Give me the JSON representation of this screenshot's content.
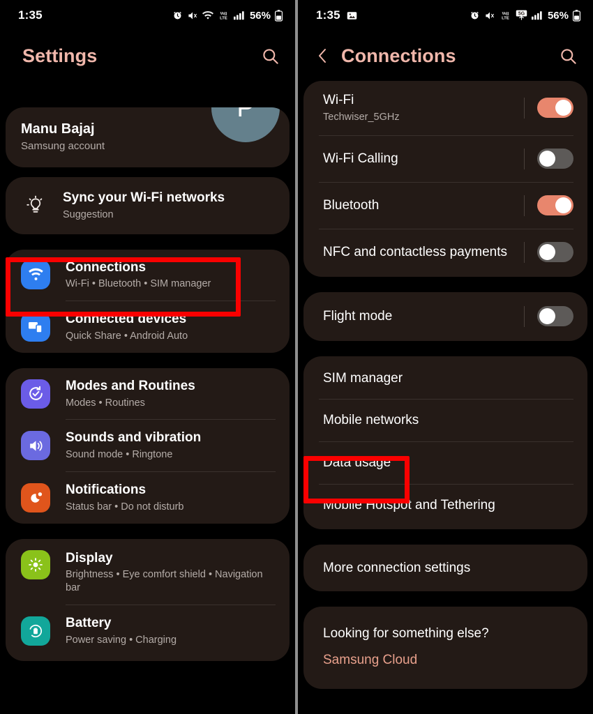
{
  "accent": "#f0b7ab",
  "highlight_color": "#fa0000",
  "card_bg": "#231a16",
  "toggle_on_color": "#e8866d",
  "toggle_off_color": "#5d5a58",
  "left_panel": {
    "statusbar": {
      "time": "1:35",
      "battery": "56%",
      "icons": [
        "alarm-icon",
        "mute-icon",
        "wifi-icon",
        "volte-icon",
        "signal-icon",
        "battery-icon"
      ]
    },
    "header": {
      "title": "Settings",
      "search_icon": "search-icon"
    },
    "profile": {
      "name": "Manu Bajaj",
      "subtitle": "Samsung account",
      "avatar_initial": "P"
    },
    "suggestion": {
      "title": "Sync your Wi-Fi networks",
      "subtitle": "Suggestion",
      "icon": "lightbulb-icon"
    },
    "groups": [
      {
        "items": [
          {
            "title": "Connections",
            "subtitle": "Wi-Fi  •  Bluetooth  •  SIM manager",
            "icon": "wifi-icon",
            "icon_color": "#2e7ef0",
            "highlighted": true
          },
          {
            "title": "Connected devices",
            "subtitle": "Quick Share  •  Android Auto",
            "icon": "devices-icon",
            "icon_color": "#2e7ef0",
            "highlighted": false
          }
        ]
      },
      {
        "items": [
          {
            "title": "Modes and Routines",
            "subtitle": "Modes  •  Routines",
            "icon": "modes-icon",
            "icon_color": "#6b5ce7",
            "highlighted": false
          },
          {
            "title": "Sounds and vibration",
            "subtitle": "Sound mode  •  Ringtone",
            "icon": "sound-icon",
            "icon_color": "#6b6ae0",
            "highlighted": false
          },
          {
            "title": "Notifications",
            "subtitle": "Status bar  •  Do not disturb",
            "icon": "notifications-icon",
            "icon_color": "#e0551c",
            "highlighted": false
          }
        ]
      },
      {
        "items": [
          {
            "title": "Display",
            "subtitle": "Brightness  •  Eye comfort shield  •  Navigation bar",
            "icon": "display-icon",
            "icon_color": "#8ac21a",
            "highlighted": false
          },
          {
            "title": "Battery",
            "subtitle": "Power saving  •  Charging",
            "icon": "battery-icon",
            "icon_color": "#12a79a",
            "highlighted": false
          }
        ]
      }
    ]
  },
  "right_panel": {
    "statusbar": {
      "time": "1:35",
      "battery": "56%",
      "icons": [
        "image-icon",
        "alarm-icon",
        "mute-icon",
        "volte-icon",
        "5g-icon",
        "signal-icon",
        "battery-icon"
      ]
    },
    "header": {
      "title": "Connections",
      "back_icon": "back-chevron-icon",
      "search_icon": "search-icon"
    },
    "groups": [
      {
        "items": [
          {
            "title": "Wi-Fi",
            "subtitle": "Techwiser_5GHz",
            "toggle": "on"
          },
          {
            "title": "Wi-Fi Calling",
            "subtitle": "",
            "toggle": "off"
          },
          {
            "title": "Bluetooth",
            "subtitle": "",
            "toggle": "on"
          },
          {
            "title": "NFC and contactless payments",
            "subtitle": "",
            "toggle": "off"
          }
        ]
      },
      {
        "items": [
          {
            "title": "Flight mode",
            "subtitle": "",
            "toggle": "off"
          }
        ]
      },
      {
        "items": [
          {
            "title": "SIM manager",
            "subtitle": "",
            "toggle": null,
            "highlighted": false
          },
          {
            "title": "Mobile networks",
            "subtitle": "",
            "toggle": null,
            "highlighted": false
          },
          {
            "title": "Data usage",
            "subtitle": "",
            "toggle": null,
            "highlighted": true
          },
          {
            "title": "Mobile Hotspot and Tethering",
            "subtitle": "",
            "toggle": null,
            "highlighted": false
          }
        ]
      },
      {
        "items": [
          {
            "title": "More connection settings",
            "subtitle": "",
            "toggle": null,
            "highlighted": false
          }
        ]
      }
    ],
    "footer": {
      "question": "Looking for something else?",
      "link": "Samsung Cloud"
    }
  }
}
